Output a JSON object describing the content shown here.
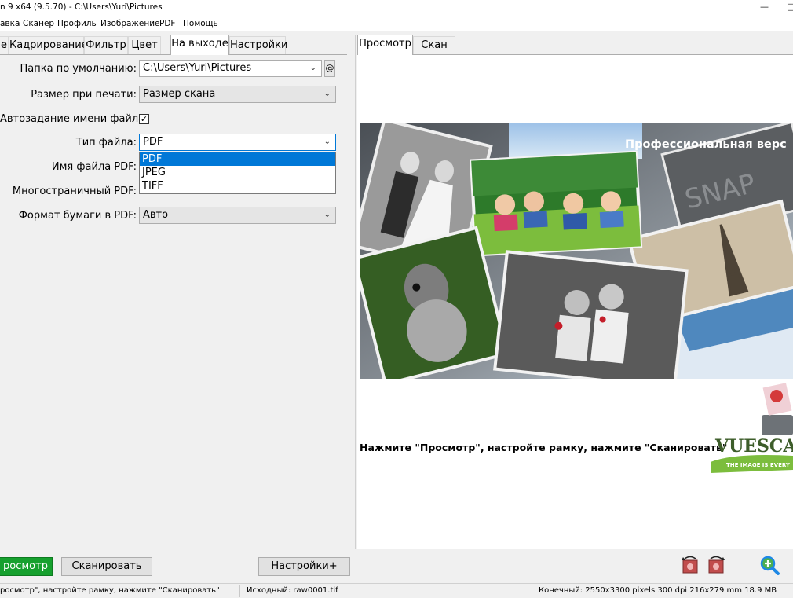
{
  "window": {
    "title": "n 9 x64 (9.5.70) - C:\\Users\\Yuri\\Pictures",
    "minimize_glyph": "—",
    "restore_glyph": "□"
  },
  "menu": [
    "авка",
    "Сканер",
    "Профиль",
    "Изображение",
    "PDF",
    "Помощь"
  ],
  "left_tabs": [
    "е",
    "Кадрирование",
    "Фильтр",
    "Цвет",
    "На выходе",
    "Настройки"
  ],
  "right_tabs": [
    "Просмотр",
    "Скан"
  ],
  "form": {
    "default_folder_label": "Папка по умолчанию:",
    "default_folder_value": "C:\\Users\\Yuri\\Pictures",
    "at_label": "@",
    "print_size_label": "Размер при печати:",
    "print_size_value": "Размер скана",
    "auto_name_label": "Автозадание имени файла:",
    "auto_name_checked": "✓",
    "file_type_label": "Тип файла:",
    "file_type_value": "PDF",
    "file_type_options": [
      "PDF",
      "JPEG",
      "TIFF"
    ],
    "pdf_name_label": "Имя файла PDF:",
    "multipage_label": "Многостраничный PDF:",
    "paper_format_label": "Формат бумаги в PDF:",
    "paper_format_value": "Авто"
  },
  "preview": {
    "banner_title": "Профессиональная верс",
    "instruction": "Нажмите \"Просмотр\", настройте рамку, нажмите \"Сканировать\"",
    "logo_text": "VUESCA",
    "logo_tagline": "THE IMAGE IS EVERY"
  },
  "buttons": {
    "preview": "росмотр",
    "scan": "Сканировать",
    "settings": "Настройки+"
  },
  "status": {
    "hint": "росмотр\", настройте рамку, нажмите \"Сканировать\"",
    "source": "Исходный: raw0001.tif",
    "output": "Конечный: 2550x3300 pixels 300 dpi 216x279 mm 18.9 MB"
  },
  "icons": [
    "rotate-left-icon",
    "rotate-right-icon",
    "zoom-in-icon"
  ],
  "colors": {
    "accent": "#0078d7",
    "preview_button": "#16a02e"
  }
}
